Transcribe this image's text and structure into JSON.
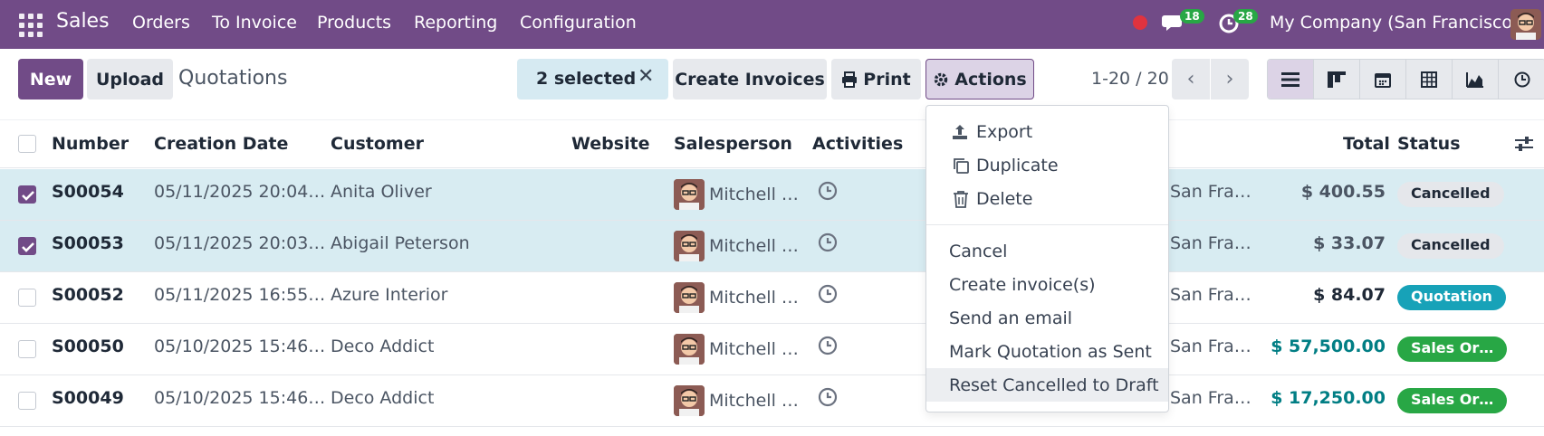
{
  "navbar": {
    "app_name": "Sales",
    "menu": [
      "Orders",
      "To Invoice",
      "Products",
      "Reporting",
      "Configuration"
    ],
    "messages_count": "18",
    "activities_count": "28",
    "company": "My Company (San Francisco)",
    "colors": {
      "bar": "#714b87",
      "badge": "#28a745",
      "record_dot": "#e0333f"
    }
  },
  "control_panel": {
    "new_label": "New",
    "upload_label": "Upload",
    "breadcrumb": "Quotations",
    "selected_label": "2 selected",
    "create_invoices_label": "Create Invoices",
    "print_label": "Print",
    "actions_label": "Actions",
    "pager": "1-20 / 20",
    "views": [
      "list-icon",
      "kanban-icon",
      "calendar-icon",
      "pivot-icon",
      "graph-icon",
      "activity-icon"
    ]
  },
  "table": {
    "columns": [
      "Number",
      "Creation Date",
      "Customer",
      "Website",
      "Salesperson",
      "Activities",
      "Total",
      "Status"
    ],
    "rows": [
      {
        "selected": true,
        "number": "S00054",
        "date": "05/11/2025 20:04…",
        "customer": "Anita Oliver",
        "salesperson": "Mitchell …",
        "company": "San Fra…",
        "total": "$ 400.55",
        "total_color": "#4b5563",
        "status": "Cancelled",
        "status_kind": "cancel"
      },
      {
        "selected": true,
        "number": "S00053",
        "date": "05/11/2025 20:03…",
        "customer": "Abigail Peterson",
        "salesperson": "Mitchell …",
        "company": "San Fra…",
        "total": "$ 33.07",
        "total_color": "#4b5563",
        "status": "Cancelled",
        "status_kind": "cancel"
      },
      {
        "selected": false,
        "number": "S00052",
        "date": "05/11/2025 16:55…",
        "customer": "Azure Interior",
        "salesperson": "Mitchell …",
        "company": "San Fra…",
        "total": "$ 84.07",
        "total_color": "#1f2937",
        "status": "Quotation",
        "status_kind": "quote"
      },
      {
        "selected": false,
        "number": "S00050",
        "date": "05/10/2025 15:46…",
        "customer": "Deco Addict",
        "salesperson": "Mitchell …",
        "company": "San Fra…",
        "total": "$ 57,500.00",
        "total_color": "#017e84",
        "status": "Sales Or…",
        "status_kind": "order"
      },
      {
        "selected": false,
        "number": "S00049",
        "date": "05/10/2025 15:46…",
        "customer": "Deco Addict",
        "salesperson": "Mitchell …",
        "company": "San Fra…",
        "total": "$ 17,250.00",
        "total_color": "#017e84",
        "status": "Sales Or…",
        "status_kind": "order"
      }
    ]
  },
  "actions_menu": {
    "icon_items": [
      {
        "label": "Export",
        "icon": "upload-icon"
      },
      {
        "label": "Duplicate",
        "icon": "copy-icon"
      },
      {
        "label": "Delete",
        "icon": "trash-icon"
      }
    ],
    "items": [
      "Cancel",
      "Create invoice(s)",
      "Send an email",
      "Mark Quotation as Sent",
      "Reset Cancelled to Draft"
    ],
    "highlighted": "Reset Cancelled to Draft"
  }
}
